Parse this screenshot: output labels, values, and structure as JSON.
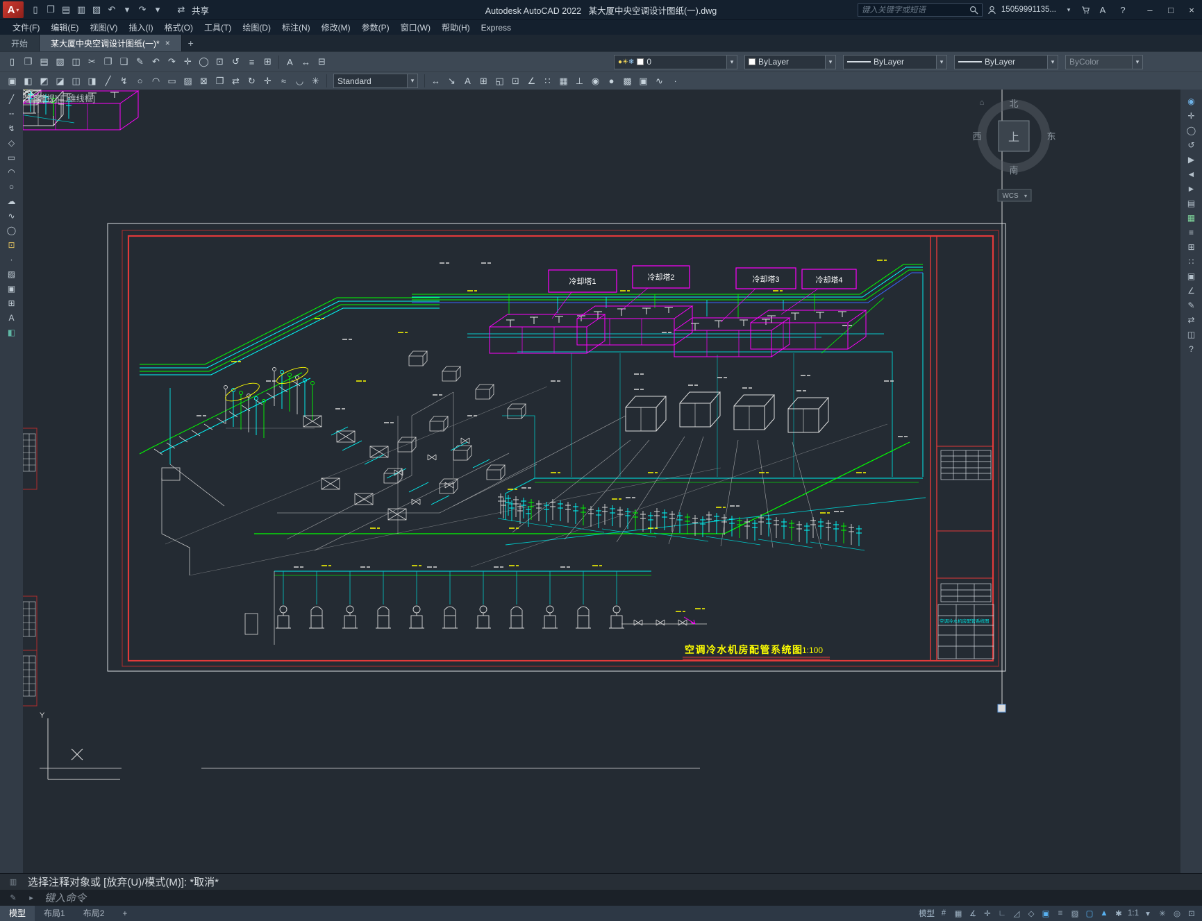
{
  "titlebar": {
    "logo_letter": "A",
    "logo_caret": "▾",
    "app_title": "Autodesk AutoCAD 2022   某大厦中央空调设计图纸(一).dwg",
    "share_label": "共享",
    "share_icon_glyph": "⇄",
    "search_placeholder": "键入关键字或短语",
    "user_id": "15059991135...",
    "user_caret": "▾",
    "help_glyph": "?",
    "window_buttons": {
      "minimize": "–",
      "maximize": "□",
      "close": "×"
    },
    "qat_icons": [
      {
        "name": "qnew-icon",
        "glyph": "▯"
      },
      {
        "name": "open-icon",
        "glyph": "❒"
      },
      {
        "name": "qsave-icon",
        "glyph": "▤"
      },
      {
        "name": "saveas-icon",
        "glyph": "▥"
      },
      {
        "name": "plot-icon",
        "glyph": "▨"
      },
      {
        "name": "undo-icon",
        "glyph": "↶"
      },
      {
        "name": "undo-dropdown-icon",
        "glyph": "▾"
      },
      {
        "name": "redo-icon",
        "glyph": "↷"
      },
      {
        "name": "redo-dropdown-icon",
        "glyph": "▾"
      }
    ]
  },
  "menubar": {
    "items": [
      "文件(F)",
      "编辑(E)",
      "视图(V)",
      "插入(I)",
      "格式(O)",
      "工具(T)",
      "绘图(D)",
      "标注(N)",
      "修改(M)",
      "参数(P)",
      "窗口(W)",
      "帮助(H)",
      "Express"
    ]
  },
  "tabs": {
    "start": "开始",
    "drawing": "某大厦中央空调设计图纸(一)*",
    "close_glyph": "×",
    "new_tab_glyph": "+"
  },
  "toolbar1": {
    "icons_left": [
      {
        "name": "new-icon",
        "glyph": "▯"
      },
      {
        "name": "open-file-icon",
        "glyph": "❒"
      },
      {
        "name": "save-icon",
        "glyph": "▤"
      },
      {
        "name": "plot-icon",
        "glyph": "▨"
      },
      {
        "name": "preview-icon",
        "glyph": "◫"
      },
      {
        "name": "cut-icon",
        "glyph": "✂"
      },
      {
        "name": "copy-icon",
        "glyph": "❐"
      },
      {
        "name": "paste-icon",
        "glyph": "❑"
      },
      {
        "name": "match-properties-icon",
        "glyph": "✎"
      },
      {
        "name": "undo-icon",
        "glyph": "↶"
      },
      {
        "name": "redo-icon",
        "glyph": "↷"
      },
      {
        "name": "pan-icon",
        "glyph": "✛"
      },
      {
        "name": "zoom-realtime-icon",
        "glyph": "◯"
      },
      {
        "name": "zoom-window-icon",
        "glyph": "⊡"
      },
      {
        "name": "orbit-icon",
        "glyph": "↺"
      },
      {
        "name": "properties-icon",
        "glyph": "≡"
      },
      {
        "name": "sheet-set-icon",
        "glyph": "⊞"
      }
    ],
    "icons_mid": [
      {
        "name": "text-icon",
        "glyph": "A"
      },
      {
        "name": "dimension-icon",
        "glyph": "↔"
      },
      {
        "name": "table-icon",
        "glyph": "⊟"
      }
    ],
    "layer": {
      "icons": [
        {
          "name": "layer-on-icon",
          "glyph": "●",
          "color": "#f5d95a"
        },
        {
          "name": "layer-sun-icon",
          "glyph": "☀",
          "color": "#f5d95a"
        },
        {
          "name": "layer-freeze-icon",
          "glyph": "❄",
          "color": "#9fd4ff"
        }
      ],
      "swatch_color": "#ffffff",
      "value": "0",
      "arrow": "▾"
    },
    "color_combo": {
      "value": "ByLayer",
      "swatch_color": "#ffffff",
      "arrow": "▾"
    },
    "linetype_combo": {
      "value": "ByLayer",
      "arrow": "▾"
    },
    "lineweight_combo": {
      "value": "ByLayer",
      "arrow": "▾"
    },
    "plotstyle_combo": {
      "value": "ByColor",
      "arrow": "▾"
    }
  },
  "toolbar2": {
    "icons_left": [
      {
        "name": "layer-properties-icon",
        "glyph": "▣"
      },
      {
        "name": "layer-off-icon",
        "glyph": "◧"
      },
      {
        "name": "layer-isolate-icon",
        "glyph": "◩"
      },
      {
        "name": "layer-freeze-icon",
        "glyph": "◪"
      },
      {
        "name": "layer-lock-icon",
        "glyph": "◫"
      },
      {
        "name": "layer-previous-icon",
        "glyph": "◨"
      },
      {
        "name": "line-icon",
        "glyph": "╱"
      },
      {
        "name": "polyline-icon",
        "glyph": "↯"
      },
      {
        "name": "circle-icon",
        "glyph": "○"
      },
      {
        "name": "arc-icon",
        "glyph": "◠"
      },
      {
        "name": "rectangle-icon",
        "glyph": "▭"
      },
      {
        "name": "hatch-icon",
        "glyph": "▨"
      },
      {
        "name": "erase-icon",
        "glyph": "⊠"
      },
      {
        "name": "copy-object-icon",
        "glyph": "❐"
      },
      {
        "name": "mirror-icon",
        "glyph": "⇄"
      },
      {
        "name": "rotate-icon",
        "glyph": "↻"
      },
      {
        "name": "move-icon",
        "glyph": "✛"
      },
      {
        "name": "offset-icon",
        "glyph": "≈"
      },
      {
        "name": "fillet-icon",
        "glyph": "◡"
      },
      {
        "name": "explode-icon",
        "glyph": "✳"
      }
    ],
    "style_combo": {
      "value": "Standard",
      "arrow": "▾"
    },
    "icons_right": [
      {
        "name": "dim-linear-icon",
        "glyph": "↔"
      },
      {
        "name": "leader-icon",
        "glyph": "↘"
      },
      {
        "name": "mtext-icon",
        "glyph": "A"
      },
      {
        "name": "table-icon",
        "glyph": "⊞"
      },
      {
        "name": "insert-block-icon",
        "glyph": "◱"
      },
      {
        "name": "make-block-icon",
        "glyph": "⊡"
      },
      {
        "name": "measure-icon",
        "glyph": "∠"
      },
      {
        "name": "array-icon",
        "glyph": "∷"
      },
      {
        "name": "group-icon",
        "glyph": "▦"
      },
      {
        "name": "ucs-icon",
        "glyph": "⊥"
      },
      {
        "name": "named-views-icon",
        "glyph": "◉"
      },
      {
        "name": "render-icon",
        "glyph": "●"
      },
      {
        "name": "materials-icon",
        "glyph": "▩"
      },
      {
        "name": "region-icon",
        "glyph": "▣"
      },
      {
        "name": "spline-icon",
        "glyph": "∿"
      },
      {
        "name": "point-icon",
        "glyph": "∙"
      }
    ]
  },
  "left_toolbar": {
    "icons": [
      {
        "name": "line-icon",
        "glyph": "╱"
      },
      {
        "name": "construction-line-icon",
        "glyph": "╌"
      },
      {
        "name": "polyline-icon",
        "glyph": "↯"
      },
      {
        "name": "polygon-icon",
        "glyph": "◇"
      },
      {
        "name": "rectangle-icon",
        "glyph": "▭"
      },
      {
        "name": "arc-icon",
        "glyph": "◠"
      },
      {
        "name": "circle-icon",
        "glyph": "○"
      },
      {
        "name": "revision-cloud-icon",
        "glyph": "☁"
      },
      {
        "name": "spline-icon",
        "glyph": "∿"
      },
      {
        "name": "ellipse-icon",
        "glyph": "◯"
      },
      {
        "name": "insert-block-icon",
        "glyph": "⊡",
        "color": "#e0c060"
      },
      {
        "name": "point-icon",
        "glyph": "∙"
      },
      {
        "name": "hatch-icon",
        "glyph": "▨"
      },
      {
        "name": "region-icon",
        "glyph": "▣"
      },
      {
        "name": "table-icon",
        "glyph": "⊞"
      },
      {
        "name": "mtext-icon",
        "glyph": "A"
      },
      {
        "name": "palette-icon",
        "glyph": "◧",
        "color": "#5fb7a5"
      }
    ]
  },
  "right_toolbar": {
    "icons": [
      {
        "name": "navigation-wheel-icon",
        "glyph": "◉",
        "color": "#6fb3e8"
      },
      {
        "name": "pan-icon",
        "glyph": "✛"
      },
      {
        "name": "zoom-extents-icon",
        "glyph": "◯"
      },
      {
        "name": "orbit-icon",
        "glyph": "↺"
      },
      {
        "name": "show-motion-icon",
        "glyph": "▶"
      },
      {
        "name": "view-back-icon",
        "glyph": "◄"
      },
      {
        "name": "view-forward-icon",
        "glyph": "►"
      },
      {
        "name": "sheet-manager-icon",
        "glyph": "▤"
      },
      {
        "name": "tool-palettes-icon",
        "glyph": "▦",
        "color": "#7ed49a"
      },
      {
        "name": "properties-panel-icon",
        "glyph": "≡"
      },
      {
        "name": "blocks-panel-icon",
        "glyph": "⊞"
      },
      {
        "name": "count-icon",
        "glyph": "∷"
      },
      {
        "name": "layer-panel-icon",
        "glyph": "▣"
      },
      {
        "name": "measure-icon",
        "glyph": "∠"
      },
      {
        "name": "markup-icon",
        "glyph": "✎"
      },
      {
        "name": "share-view-icon",
        "glyph": "⇄"
      },
      {
        "name": "compare-icon",
        "glyph": "◫"
      },
      {
        "name": "help-icon",
        "glyph": "?"
      }
    ]
  },
  "viewport": {
    "view_label": "[-][俯视][二维线框]",
    "compass": {
      "n": "北",
      "s": "南",
      "w": "西",
      "e": "东",
      "up": "上",
      "home": "⌂"
    },
    "wcs_label": "WCS",
    "wcs_arrow": "▾",
    "ucs_y_label": "Y",
    "towers": [
      "冷却塔1",
      "冷却塔2",
      "冷却塔3",
      "冷却塔4"
    ],
    "drawing_title": "空调冷水机房配管系统图",
    "drawing_scale": "1:100",
    "titleblock_name": "空调冷水机房配管系统图"
  },
  "command": {
    "panel_icon_glyph": "▥",
    "history": "选择注释对象或 [放弃(U)/模式(M)]: *取消*",
    "prompt": "键入命令",
    "input_icons": [
      {
        "name": "command-customize-icon",
        "glyph": "✎"
      },
      {
        "name": "command-recent-icon",
        "glyph": "▸"
      }
    ]
  },
  "statusbar": {
    "layout_tabs": [
      {
        "label": "模型",
        "active": true
      },
      {
        "label": "布局1"
      },
      {
        "label": "布局2"
      }
    ],
    "new_layout_glyph": "+",
    "right_icons": [
      {
        "name": "model-paper-toggle",
        "label": "模型"
      },
      {
        "name": "grid-icon",
        "glyph": "#"
      },
      {
        "name": "snap-icon",
        "glyph": "▦"
      },
      {
        "name": "infer-constraints-icon",
        "glyph": "∡"
      },
      {
        "name": "dynamic-input-icon",
        "glyph": "✛"
      },
      {
        "name": "ortho-icon",
        "glyph": "∟"
      },
      {
        "name": "polar-icon",
        "glyph": "◿"
      },
      {
        "name": "isodraft-icon",
        "glyph": "◇"
      },
      {
        "name": "osnap-icon",
        "glyph": "▣",
        "color": "#58b2f2"
      },
      {
        "name": "lineweight-icon",
        "glyph": "≡"
      },
      {
        "name": "transparency-icon",
        "glyph": "▨"
      },
      {
        "name": "selection-cycling-icon",
        "glyph": "▢",
        "color": "#58b2f2"
      },
      {
        "name": "annotation-visibility-icon",
        "glyph": "▲",
        "color": "#58b2f2"
      },
      {
        "name": "autoscale-icon",
        "glyph": "✱"
      },
      {
        "name": "annotation-scale-label",
        "label": "1:1"
      },
      {
        "name": "scale-dropdown-icon",
        "glyph": "▾"
      },
      {
        "name": "workspace-gear-icon",
        "glyph": "✳"
      },
      {
        "name": "isolate-objects-icon",
        "glyph": "◎"
      },
      {
        "name": "clean-screen-icon",
        "glyph": "⊡"
      }
    ]
  }
}
